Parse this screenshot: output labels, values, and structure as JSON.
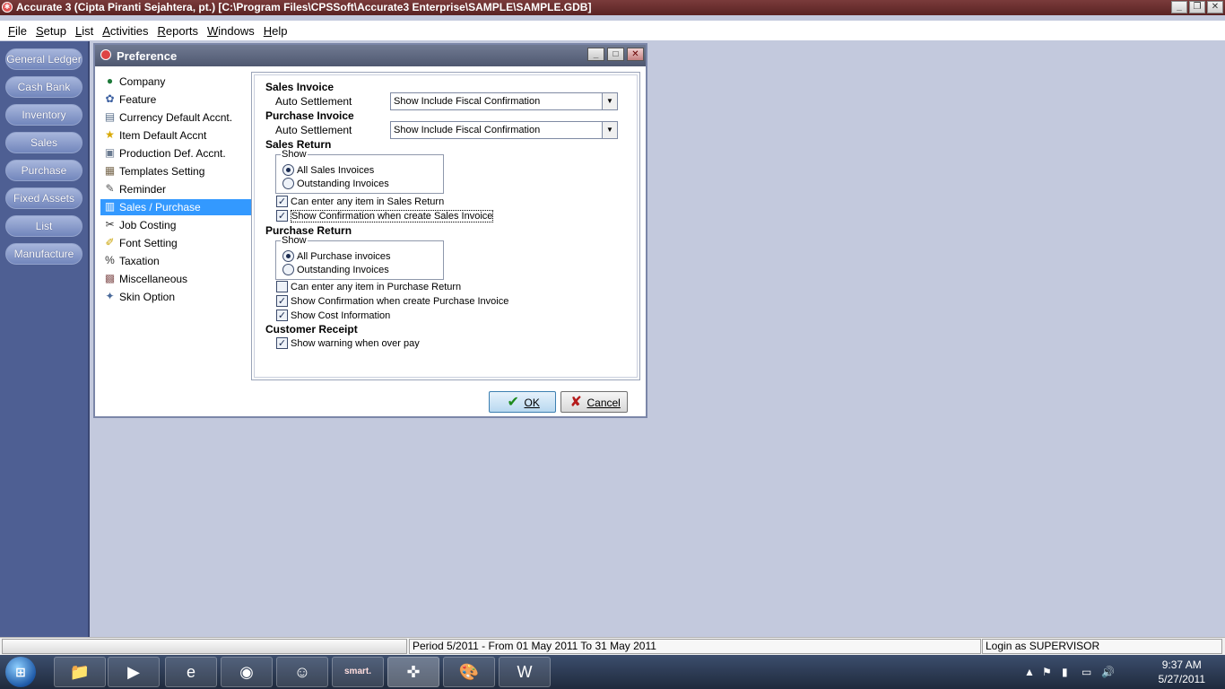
{
  "window": {
    "title": "Accurate 3  (Cipta Piranti Sejahtera, pt.)  [C:\\Program Files\\CPSSoft\\Accurate3 Enterprise\\SAMPLE\\SAMPLE.GDB]"
  },
  "menu": {
    "items": [
      {
        "key": "F",
        "rest": "ile"
      },
      {
        "key": "S",
        "rest": "etup"
      },
      {
        "key": "L",
        "rest": "ist"
      },
      {
        "key": "A",
        "rest": "ctivities"
      },
      {
        "key": "R",
        "rest": "eports"
      },
      {
        "key": "W",
        "rest": "indows"
      },
      {
        "key": "H",
        "rest": "elp"
      }
    ]
  },
  "nav": {
    "buttons": [
      "General Ledger",
      "Cash Bank",
      "Inventory",
      "Sales",
      "Purchase",
      "Fixed Assets",
      "List",
      "Manufacture"
    ]
  },
  "dialog": {
    "title": "Preference",
    "tree": [
      {
        "label": "Company",
        "icon": "globe-icon",
        "selected": false
      },
      {
        "label": "Feature",
        "icon": "gear-icon",
        "selected": false
      },
      {
        "label": "Currency Default Accnt.",
        "icon": "currency-icon",
        "selected": false
      },
      {
        "label": "Item Default Accnt",
        "icon": "star-icon",
        "selected": false
      },
      {
        "label": "Production Def. Accnt.",
        "icon": "production-icon",
        "selected": false
      },
      {
        "label": "Templates Setting",
        "icon": "template-icon",
        "selected": false
      },
      {
        "label": "Reminder",
        "icon": "reminder-icon",
        "selected": false
      },
      {
        "label": "Sales / Purchase",
        "icon": "sales-purchase-icon",
        "selected": true
      },
      {
        "label": "Job Costing",
        "icon": "job-costing-icon",
        "selected": false
      },
      {
        "label": "Font Setting",
        "icon": "font-icon",
        "selected": false
      },
      {
        "label": "Taxation",
        "icon": "taxation-icon",
        "selected": false
      },
      {
        "label": "Miscellaneous",
        "icon": "miscellaneous-icon",
        "selected": false
      },
      {
        "label": "Skin Option",
        "icon": "skin-icon",
        "selected": false
      }
    ],
    "sales_invoice": {
      "heading": "Sales Invoice",
      "auto_label": "Auto Settlement",
      "auto_value": "Show Include Fiscal Confirmation"
    },
    "purchase_invoice": {
      "heading": "Purchase Invoice",
      "auto_label": "Auto Settlement",
      "auto_value": "Show Include Fiscal Confirmation"
    },
    "sales_return": {
      "heading": "Sales Return",
      "show_label": "Show",
      "options": [
        {
          "label": "All Sales Invoices",
          "selected": true
        },
        {
          "label": "Outstanding Invoices",
          "selected": false
        }
      ],
      "checks": [
        {
          "label": "Can enter any item in Sales Return",
          "checked": true
        },
        {
          "label": "Show Confirmation when create Sales Invoice",
          "checked": true
        }
      ]
    },
    "purchase_return": {
      "heading": "Purchase Return",
      "show_label": "Show",
      "options": [
        {
          "label": "All Purchase invoices",
          "selected": true
        },
        {
          "label": "Outstanding Invoices",
          "selected": false
        }
      ],
      "checks": [
        {
          "label": "Can enter any item in Purchase Return",
          "checked": false
        },
        {
          "label": "Show Confirmation when create Purchase Invoice",
          "checked": true
        },
        {
          "label": "Show Cost Information",
          "checked": true
        }
      ]
    },
    "customer_receipt": {
      "heading": "Customer Receipt",
      "checks": [
        {
          "label": "Show warning when over pay",
          "checked": true
        }
      ]
    },
    "ok_label": "OK",
    "cancel_label": "Cancel"
  },
  "statusbar": {
    "period": "Period 5/2011 - From 01 May 2011 To 31 May 2011",
    "login": "Login as SUPERVISOR"
  },
  "taskbar": {
    "apps": [
      "explorer-icon",
      "media-player-icon",
      "internet-explorer-icon",
      "firefox-icon",
      "yahoo-messenger-icon",
      "smart-icon",
      "accurate-icon",
      "paint-icon",
      "word-icon"
    ],
    "smart_label": "smart.",
    "time": "9:37 AM",
    "date": "5/27/2011"
  }
}
